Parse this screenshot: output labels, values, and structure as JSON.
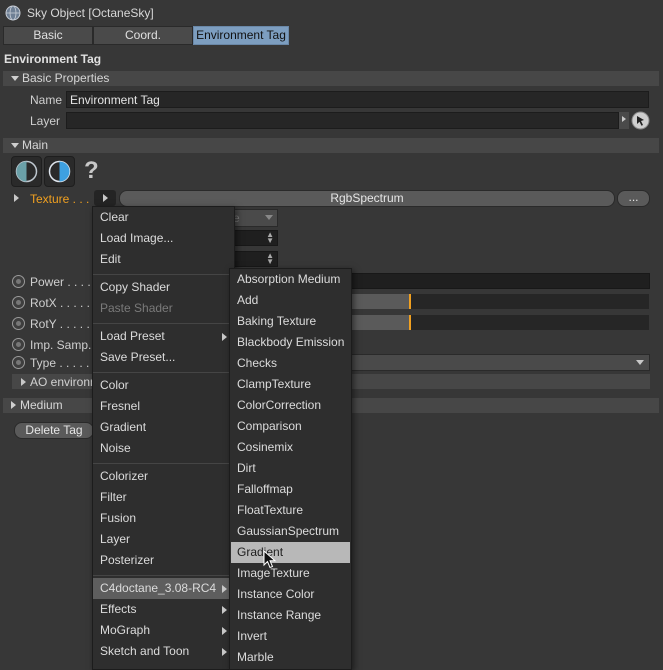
{
  "window": {
    "title": "Sky Object [OctaneSky]"
  },
  "tabs": [
    {
      "label": "Basic"
    },
    {
      "label": "Coord."
    },
    {
      "label": "Environment Tag"
    }
  ],
  "section_title": "Environment Tag",
  "basic_properties": {
    "header": "Basic Properties",
    "name_label": "Name",
    "name_value": "Environment Tag",
    "layer_label": "Layer"
  },
  "main": {
    "header": "Main",
    "help_glyph": "?",
    "texture_label": "Texture . . .",
    "texture_value": "RgbSpectrum",
    "texture_more": "...",
    "params": [
      {
        "label": "Power . . . ."
      },
      {
        "label": "RotX . . . . ."
      },
      {
        "label": "RotY . . . . ."
      },
      {
        "label": "Imp. Samp."
      },
      {
        "label": "Type . . . . ."
      }
    ],
    "ao_label": "AO environm",
    "hidden_select_fragment": "e"
  },
  "medium": {
    "header": "Medium"
  },
  "delete_tag_label": "Delete Tag",
  "context_menu": {
    "items": [
      {
        "label": "Clear",
        "disabled": false
      },
      {
        "label": "Load Image...",
        "disabled": false
      },
      {
        "label": "Edit",
        "disabled": false
      },
      {
        "label": "Copy Shader",
        "disabled": false
      },
      {
        "label": "Paste Shader",
        "disabled": true
      },
      {
        "label": "Load Preset",
        "disabled": false
      },
      {
        "label": "Save Preset...",
        "disabled": false
      },
      {
        "label": "Color",
        "disabled": false
      },
      {
        "label": "Fresnel",
        "disabled": false
      },
      {
        "label": "Gradient",
        "disabled": false
      },
      {
        "label": "Noise",
        "disabled": false
      },
      {
        "label": "Colorizer",
        "disabled": false
      },
      {
        "label": "Filter",
        "disabled": false
      },
      {
        "label": "Fusion",
        "disabled": false
      },
      {
        "label": "Layer",
        "disabled": false
      },
      {
        "label": "Posterizer",
        "disabled": false
      },
      {
        "label": "C4doctane_3.08-RC4",
        "disabled": false
      },
      {
        "label": "Effects",
        "disabled": false
      },
      {
        "label": "MoGraph",
        "disabled": false
      },
      {
        "label": "Sketch and Toon",
        "disabled": false
      }
    ]
  },
  "submenu": {
    "items": [
      {
        "label": "Absorption Medium"
      },
      {
        "label": "Add"
      },
      {
        "label": "Baking Texture"
      },
      {
        "label": "Blackbody Emission"
      },
      {
        "label": "Checks"
      },
      {
        "label": "ClampTexture"
      },
      {
        "label": "ColorCorrection"
      },
      {
        "label": "Comparison"
      },
      {
        "label": "Cosinemix"
      },
      {
        "label": "Dirt"
      },
      {
        "label": "Falloffmap"
      },
      {
        "label": "FloatTexture"
      },
      {
        "label": "GaussianSpectrum"
      },
      {
        "label": "Gradient"
      },
      {
        "label": "ImageTexture"
      },
      {
        "label": "Instance Color"
      },
      {
        "label": "Instance Range"
      },
      {
        "label": "Invert"
      },
      {
        "label": "Marble"
      }
    ]
  },
  "colors": {
    "accent_orange": "#f0a020",
    "tab_active": "#7d9ec0",
    "highlight": "#b8b8b8"
  },
  "icons": {
    "title": "sphere-globe-icon",
    "pointer": "pick-arrow-icon",
    "cursor": "mouse-pointer-icon"
  }
}
